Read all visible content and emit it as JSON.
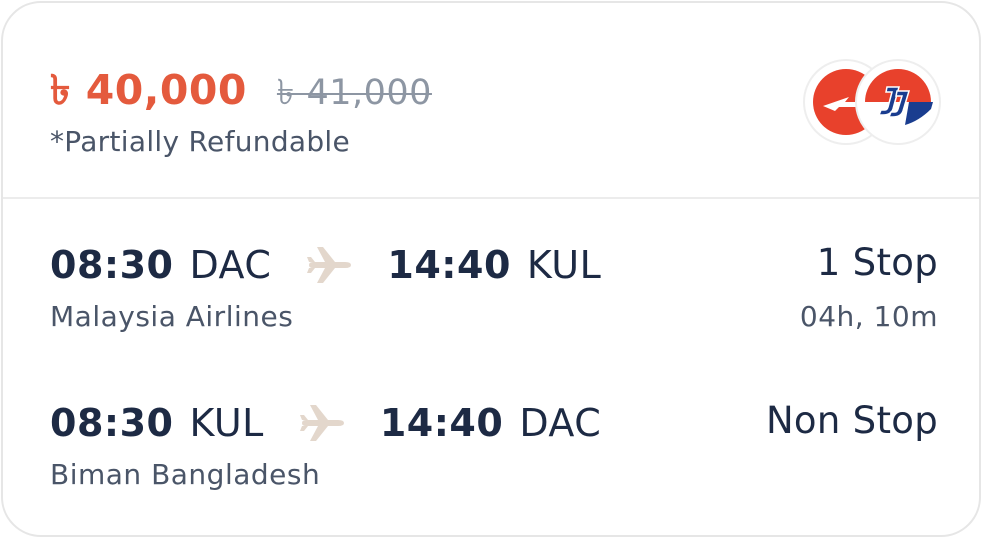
{
  "fare": {
    "price": "৳ 40,000",
    "old_price": "৳ 41,000",
    "refund_note": "*Partially Refundable",
    "price_color": "#e45a3d"
  },
  "logos": [
    {
      "icon": "malaysia-airlines-kite-icon",
      "color": "#e8412c"
    },
    {
      "icon": "malaysia-airlines-mh-icon",
      "color": "#1a3d8f"
    }
  ],
  "legs": [
    {
      "depart_time": "08:30",
      "depart_code": "DAC",
      "arrive_time": "14:40",
      "arrive_code": "KUL",
      "airline": "Malaysia Airlines",
      "stops": "1 Stop",
      "duration": "04h, 10m"
    },
    {
      "depart_time": "08:30",
      "depart_code": "KUL",
      "arrive_time": "14:40",
      "arrive_code": "DAC",
      "airline": "Biman Bangladesh",
      "stops": "Non Stop",
      "duration": ""
    }
  ]
}
